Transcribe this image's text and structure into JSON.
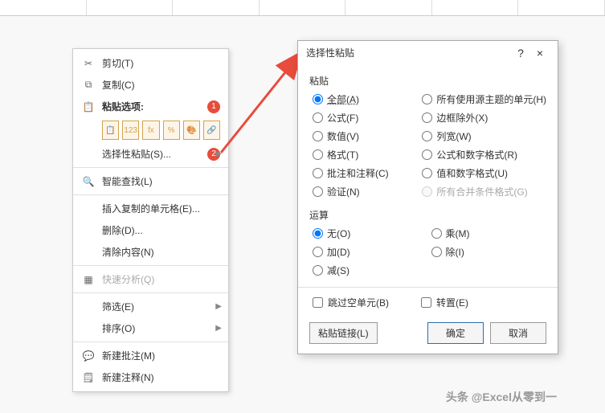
{
  "context_menu": {
    "cut": "剪切(T)",
    "copy": "复制(C)",
    "paste_options": "粘贴选项:",
    "paste_special": "选择性粘贴(S)...",
    "smart_lookup": "智能查找(L)",
    "insert_copied": "插入复制的单元格(E)...",
    "delete": "删除(D)...",
    "clear": "清除内容(N)",
    "quick_analysis": "快速分析(Q)",
    "filter": "筛选(E)",
    "sort": "排序(O)",
    "new_comment": "新建批注(M)",
    "new_note": "新建注释(N)",
    "paste_icons": [
      "📋",
      "123",
      "fx",
      "%",
      "🎨",
      "🔗"
    ]
  },
  "badges": {
    "one": "1",
    "two": "2"
  },
  "dialog": {
    "title": "选择性粘贴",
    "help": "?",
    "close": "×",
    "paste_label": "粘贴",
    "paste_opts": {
      "all": "全部(A)",
      "all_source_theme": "所有使用源主题的单元(H)",
      "formulas": "公式(F)",
      "except_borders": "边框除外(X)",
      "values": "数值(V)",
      "col_widths": "列宽(W)",
      "formats": "格式(T)",
      "formulas_num_fmt": "公式和数字格式(R)",
      "comments": "批注和注释(C)",
      "values_num_fmt": "值和数字格式(U)",
      "validation": "验证(N)",
      "all_merge_cond": "所有合并条件格式(G)"
    },
    "ops_label": "运算",
    "ops": {
      "none": "无(O)",
      "multiply": "乘(M)",
      "add": "加(D)",
      "divide": "除(I)",
      "subtract": "减(S)"
    },
    "skip_blanks": "跳过空单元(B)",
    "transpose": "转置(E)",
    "paste_link": "粘贴链接(L)",
    "ok": "确定",
    "cancel": "取消"
  },
  "watermark": "头条 @Excel从零到一"
}
